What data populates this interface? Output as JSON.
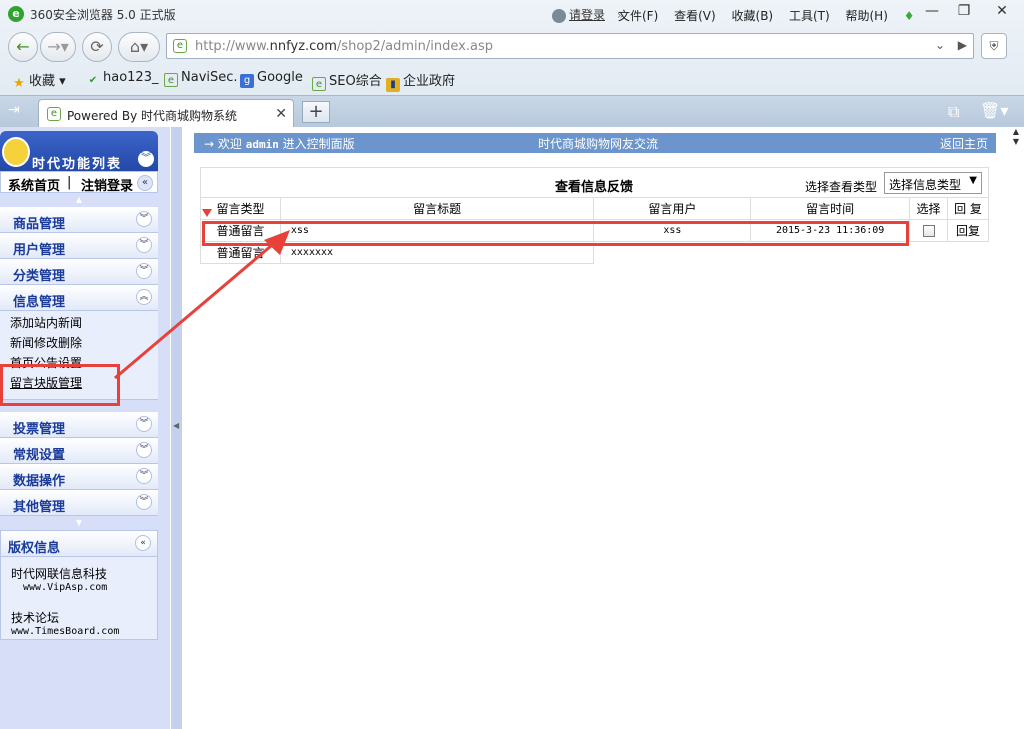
{
  "browser": {
    "title": "360安全浏览器 5.0 正式版",
    "login": "请登录",
    "menus": [
      "文件(F)",
      "查看(V)",
      "收藏(B)",
      "工具(T)",
      "帮助(H)"
    ],
    "url_prefix": "http://www.",
    "url_host": "nnfyz.com",
    "url_path": "/shop2/admin/index.asp",
    "favorites_label": "收藏",
    "bookmarks": [
      "hao123_",
      "NaviSec.",
      "Google",
      "SEO综合",
      "企业政府"
    ],
    "tab_title": "Powered By 时代商城购物系统"
  },
  "sidebar": {
    "title": "时代功能列表",
    "home": "系统首页",
    "logout": "注销登录",
    "menu": [
      "商品管理",
      "用户管理",
      "分类管理",
      "信息管理"
    ],
    "info_sub": [
      "添加站内新闻",
      "新闻修改删除",
      "首页公告设置",
      "留言块版管理"
    ],
    "menu2": [
      "投票管理",
      "常规设置",
      "数据操作",
      "其他管理"
    ],
    "copyright_title": "版权信息",
    "company": "时代网联信息科技",
    "company_url": "www.VipAsp.com",
    "forum": "技术论坛",
    "forum_url": "www.TimesBoard.com"
  },
  "topbar": {
    "welcome_prefix": "→ 欢迎",
    "user": "admin",
    "welcome_suffix": "进入控制面版",
    "center": "时代商城购物网友交流",
    "back": "返回主页"
  },
  "panel": {
    "title": "查看信息反馈",
    "filter_label": "选择查看类型",
    "filter_value": "选择信息类型",
    "columns": [
      "留言类型",
      "留言标题",
      "留言用户",
      "留言时间",
      "选择",
      "回 复"
    ],
    "rows": [
      {
        "type": "普通留言",
        "subject": "xss",
        "user": "xss",
        "time": "2015-3-23 11:36:09",
        "reply": "回复"
      },
      {
        "type": "普通留言",
        "subject": "xxxxxxx",
        "user": "",
        "time": "",
        "reply": ""
      }
    ]
  }
}
